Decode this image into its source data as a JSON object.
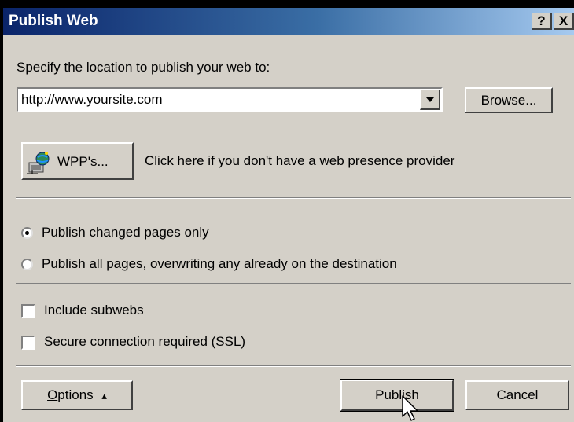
{
  "dialog": {
    "title": "Publish Web",
    "help_button": "?",
    "close_button": "X"
  },
  "location": {
    "label": "Specify the location to publish your web to:",
    "url_value": "http://www.yoursite.com",
    "browse_label": "Browse..."
  },
  "wpp": {
    "button_mnemonic": "W",
    "button_rest": "PP's...",
    "description": "Click here if you don't have a web presence provider"
  },
  "publish_options": {
    "changed_only_label": "Publish changed pages only",
    "changed_only_selected": true,
    "all_pages_label": "Publish all pages, overwriting any already on the destination",
    "all_pages_selected": false
  },
  "checkboxes": {
    "subwebs_label": "Include subwebs",
    "subwebs_checked": false,
    "ssl_label": "Secure connection required (SSL)",
    "ssl_checked": false
  },
  "buttons": {
    "options_mnemonic": "O",
    "options_rest": "ptions",
    "options_arrow": "▴",
    "publish_label": "Publish",
    "cancel_label": "Cancel"
  },
  "colors": {
    "titlebar_start": "#0a246a",
    "titlebar_end": "#a6caf0",
    "dialog_face": "#d4d0c8"
  }
}
